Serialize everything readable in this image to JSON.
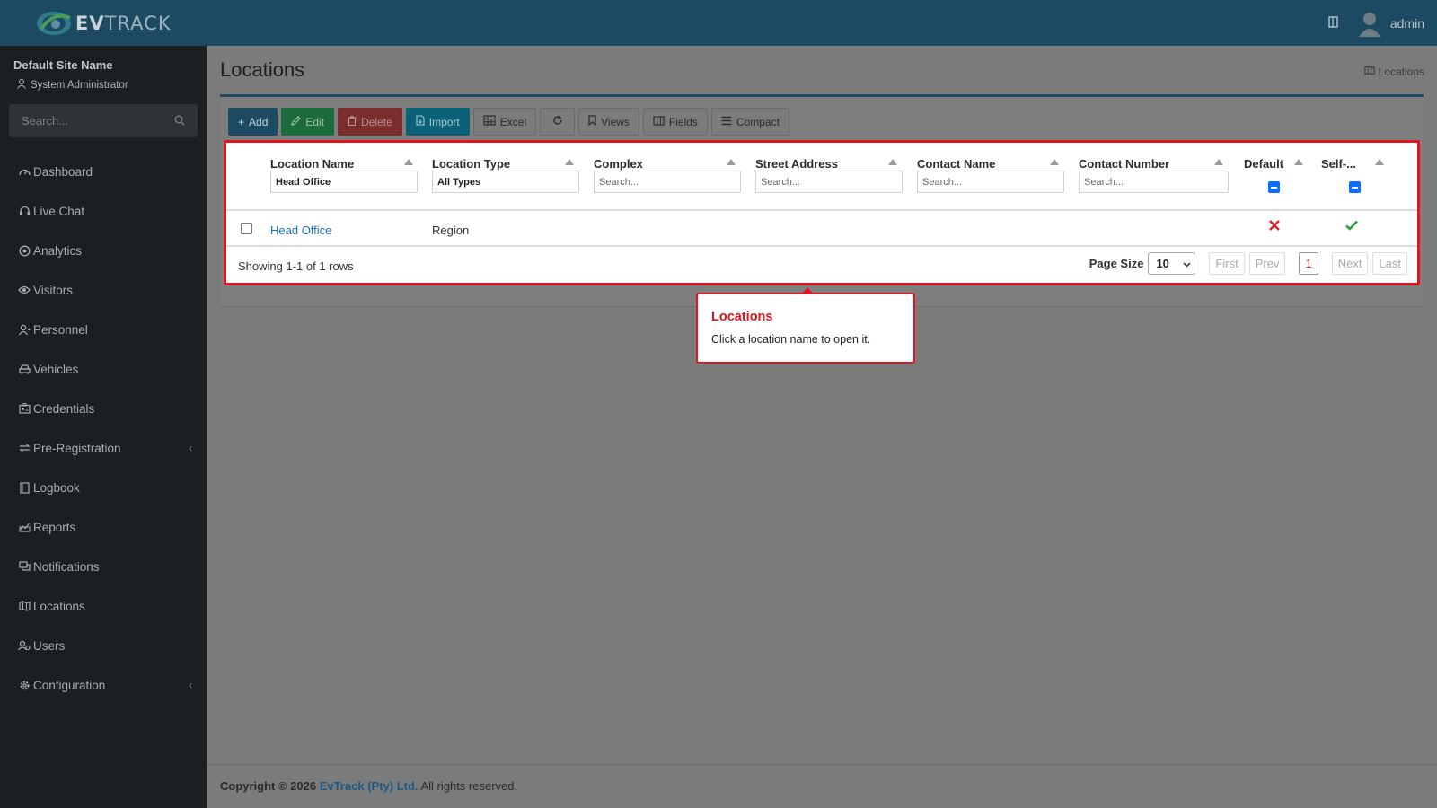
{
  "header": {
    "logo_text_bold": "EV",
    "logo_text_rest": "TRACK",
    "user_name": "admin"
  },
  "sidebar": {
    "site_name": "Default Site Name",
    "role": "System Administrator",
    "search_placeholder": "Search...",
    "items": [
      {
        "label": "Dashboard",
        "icon": "dashboard-icon"
      },
      {
        "label": "Live Chat",
        "icon": "headset-icon"
      },
      {
        "label": "Analytics",
        "icon": "target-icon"
      },
      {
        "label": "Visitors",
        "icon": "eye-icon"
      },
      {
        "label": "Personnel",
        "icon": "user-tie-icon"
      },
      {
        "label": "Vehicles",
        "icon": "car-icon"
      },
      {
        "label": "Credentials",
        "icon": "id-card-icon"
      },
      {
        "label": "Pre-Registration",
        "icon": "exchange-icon",
        "has_submenu": true
      },
      {
        "label": "Logbook",
        "icon": "book-icon"
      },
      {
        "label": "Reports",
        "icon": "chart-icon"
      },
      {
        "label": "Notifications",
        "icon": "chat-icon"
      },
      {
        "label": "Locations",
        "icon": "map-icon"
      },
      {
        "label": "Users",
        "icon": "users-icon"
      },
      {
        "label": "Configuration",
        "icon": "gear-icon",
        "has_submenu": true
      }
    ]
  },
  "page": {
    "title": "Locations",
    "breadcrumb": "Locations"
  },
  "toolbar": {
    "add": "Add",
    "edit": "Edit",
    "delete": "Delete",
    "import": "Import",
    "excel": "Excel",
    "views": "Views",
    "fields": "Fields",
    "compact": "Compact"
  },
  "table": {
    "columns": [
      {
        "label": "Location Name",
        "filter_value": "Head Office",
        "filter_placeholder": ""
      },
      {
        "label": "Location Type",
        "filter_value": "All Types",
        "filter_placeholder": ""
      },
      {
        "label": "Complex",
        "filter_value": "",
        "filter_placeholder": "Search..."
      },
      {
        "label": "Street Address",
        "filter_value": "",
        "filter_placeholder": "Search..."
      },
      {
        "label": "Contact Name",
        "filter_value": "",
        "filter_placeholder": "Search..."
      },
      {
        "label": "Contact Number",
        "filter_value": "",
        "filter_placeholder": "Search..."
      },
      {
        "label": "Default"
      },
      {
        "label": "Self-..."
      }
    ],
    "rows": [
      {
        "location_name": "Head Office",
        "location_type": "Region",
        "complex": "",
        "street_address": "",
        "contact_name": "",
        "contact_number": "",
        "default": false,
        "self": true
      }
    ],
    "status_colors": {
      "no": "#d9262c",
      "yes": "#2a9d3a"
    }
  },
  "pagination": {
    "showing": "Showing 1-1 of 1 rows",
    "page_size_label": "Page Size",
    "page_size": "10",
    "first": "First",
    "prev": "Prev",
    "current": "1",
    "next": "Next",
    "last": "Last"
  },
  "popover": {
    "title": "Locations",
    "body": "Click a location name to open it."
  },
  "footer": {
    "copyright": "Copyright © 2026",
    "company": "EvTrack (Pty) Ltd.",
    "rights": "All rights reserved."
  }
}
